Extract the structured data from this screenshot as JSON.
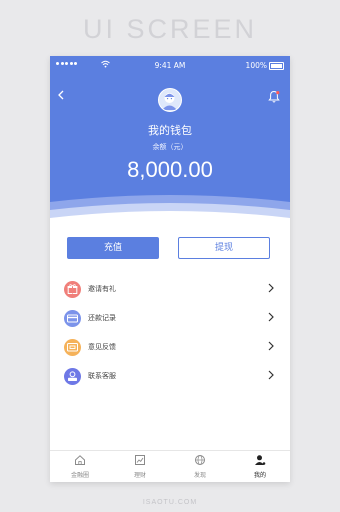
{
  "watermark": {
    "top": "UI SCREEN",
    "bottom": "ISAOTU.COM"
  },
  "status_bar": {
    "time": "9:41 AM",
    "battery": "100%"
  },
  "wallet": {
    "title": "我的钱包",
    "balance_label": "余额（元）",
    "balance": "8,000.00"
  },
  "actions": {
    "recharge": "充值",
    "withdraw": "提现"
  },
  "menu": {
    "items": [
      {
        "label": "邀请有礼",
        "icon": "gift-icon",
        "color": "#f07f7a"
      },
      {
        "label": "还款记录",
        "icon": "card-icon",
        "color": "#7b93ea"
      },
      {
        "label": "意见反馈",
        "icon": "feedback-icon",
        "color": "#f5b25a"
      },
      {
        "label": "联系客服",
        "icon": "service-icon",
        "color": "#6e78e6"
      }
    ]
  },
  "tabbar": {
    "items": [
      {
        "label": "金融圈",
        "icon": "home-icon"
      },
      {
        "label": "理财",
        "icon": "chart-icon"
      },
      {
        "label": "发现",
        "icon": "globe-icon"
      },
      {
        "label": "我的",
        "icon": "user-icon",
        "active": true
      }
    ]
  },
  "colors": {
    "primary": "#5b7fe0",
    "background": "#e9e9eb"
  }
}
